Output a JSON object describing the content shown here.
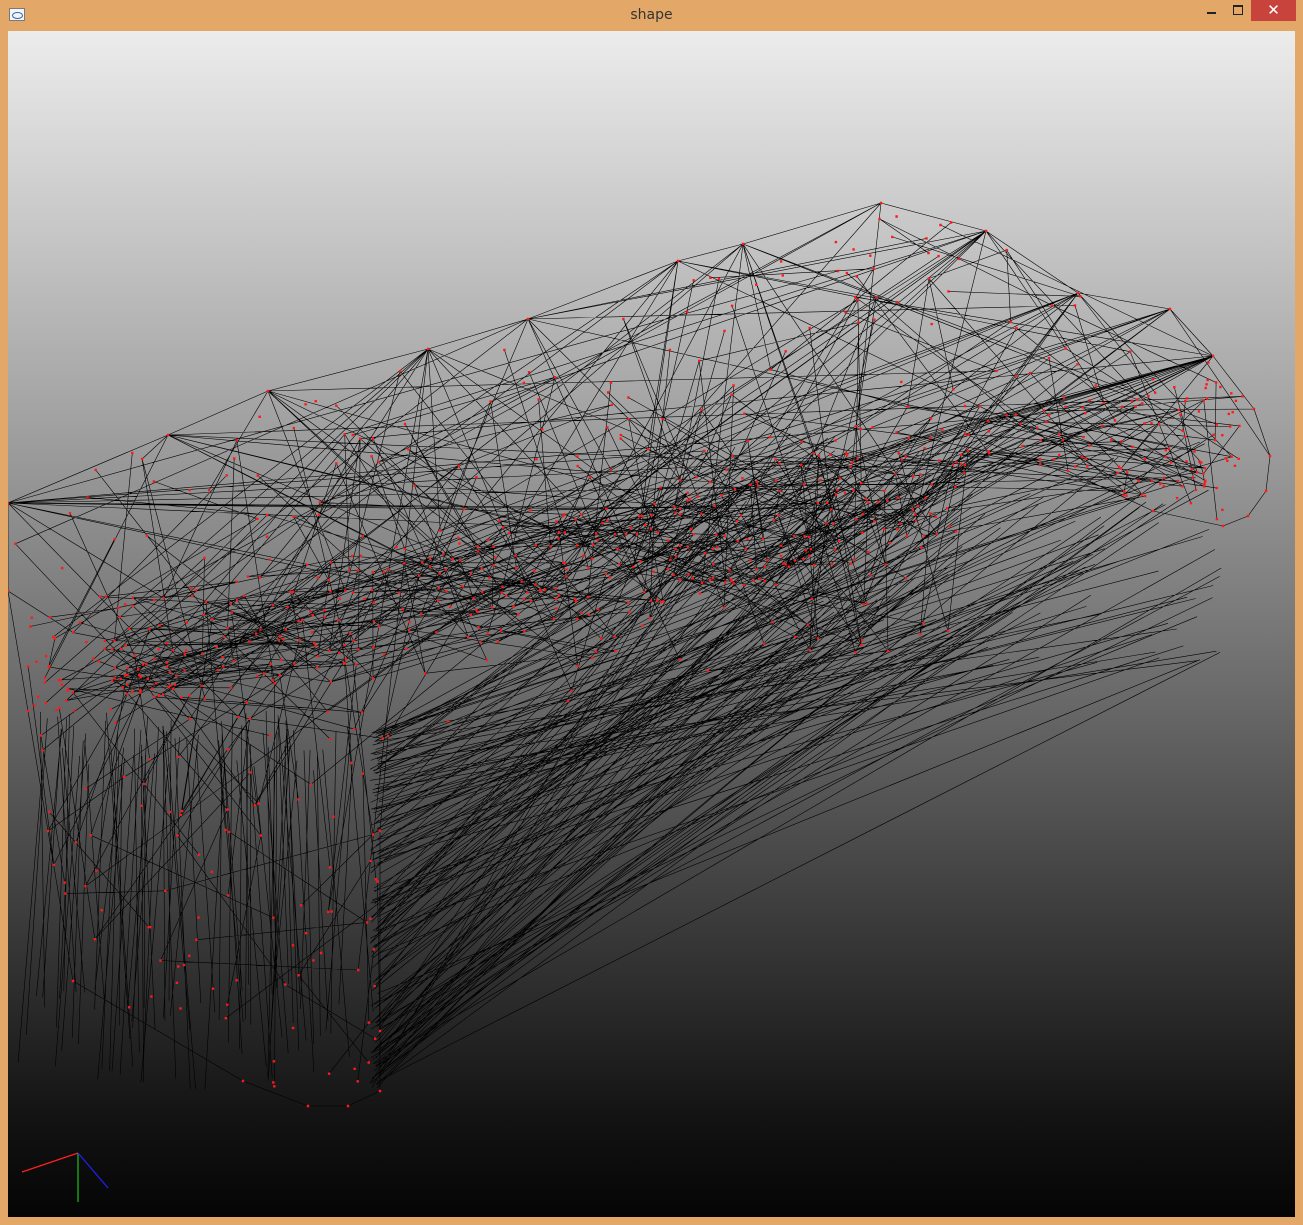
{
  "window": {
    "title": "shape",
    "app_icon": "app-window-icon",
    "controls": {
      "minimize_icon": "minimize-icon",
      "maximize_icon": "maximize-icon",
      "close_icon": "close-icon",
      "close_glyph": "✕"
    }
  },
  "viewport": {
    "content": "3d-mesh-wireframe",
    "edge_color": "#000000",
    "vertex_color": "#ff1a1a",
    "axes": {
      "x_color": "#ff2020",
      "y_color": "#20c020",
      "z_color": "#2020ff"
    }
  }
}
